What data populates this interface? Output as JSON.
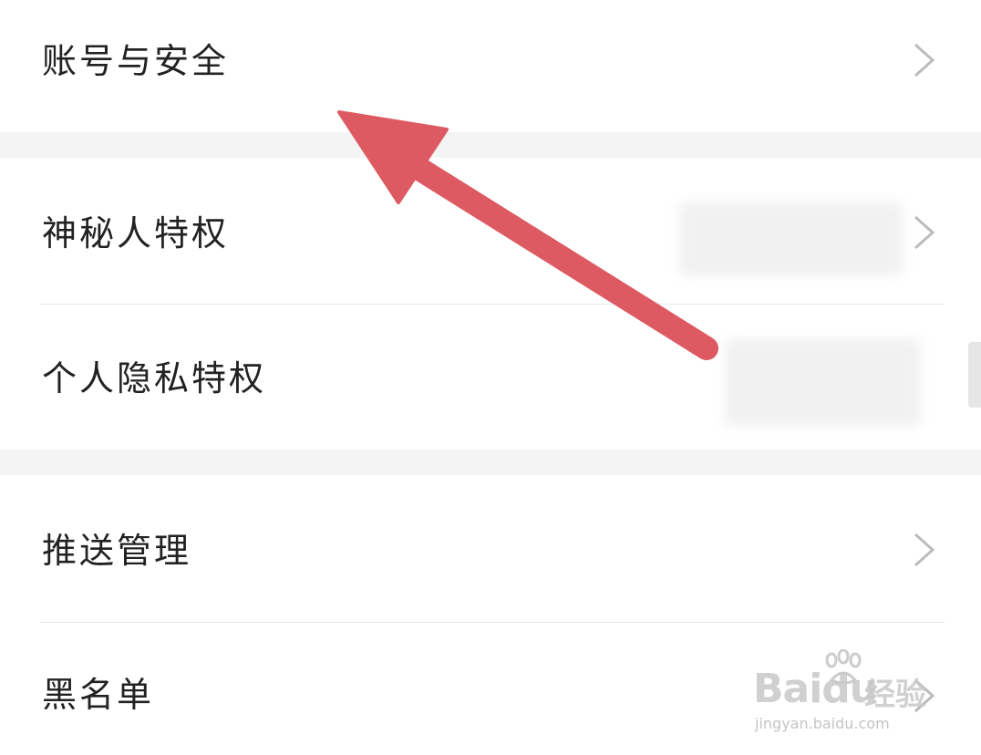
{
  "settings": {
    "items": [
      {
        "label": "账号与安全"
      },
      {
        "label": "神秘人特权"
      },
      {
        "label": "个人隐私特权"
      },
      {
        "label": "推送管理"
      },
      {
        "label": "黑名单"
      }
    ]
  },
  "watermark": {
    "brand": "Baidu",
    "cn": "经验",
    "url": "jingyan.baidu.com"
  },
  "colors": {
    "arrow": "#de5a62",
    "text": "#222222",
    "section_gap": "#f4f4f4",
    "chevron": "#bbbbbb"
  }
}
